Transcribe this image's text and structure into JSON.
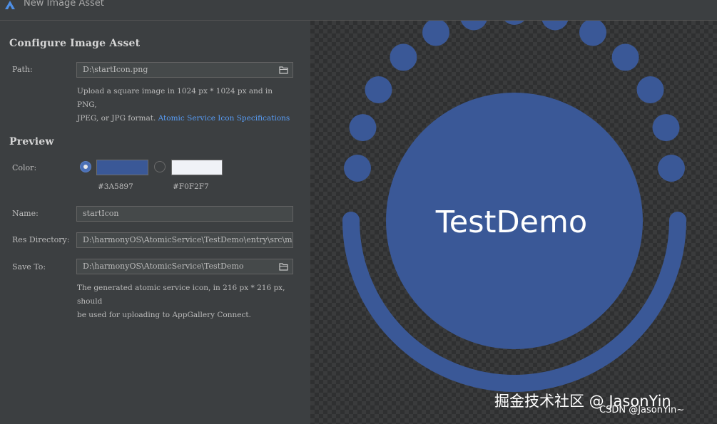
{
  "window": {
    "title": "New Image Asset"
  },
  "configure": {
    "heading": "Configure Image Asset",
    "path_label": "Path:",
    "path_value": "D:\\startIcon.png",
    "help_line1": "Upload a square image in 1024 px * 1024 px and in PNG,",
    "help_line2": "JPEG, or JPG format.",
    "help_link": "Atomic Service Icon Specifications"
  },
  "preview_section": {
    "heading": "Preview",
    "color_label": "Color:",
    "colors": [
      {
        "hex": "#3A5897",
        "selected": true
      },
      {
        "hex": "#F0F2F7",
        "selected": false
      }
    ],
    "name_label": "Name:",
    "name_value": "startIcon",
    "res_label": "Res Directory:",
    "res_value": "D:\\harmonyOS\\AtomicService\\TestDemo\\entry\\src\\main\\resources",
    "save_label": "Save To:",
    "save_value": "D:\\harmonyOS\\AtomicService\\TestDemo",
    "save_help_line1": "The generated atomic service icon, in 216 px * 216 px, should",
    "save_help_line2": "be used for uploading to AppGallery Connect."
  },
  "icon_preview": {
    "text": "TestDemo",
    "fill_color": "#3A5897",
    "text_color": "#FFFFFF",
    "dot_count": 13
  },
  "watermark": {
    "main": "掘金技术社区 @ JasonYin",
    "sub": "CSDN @JasonYin~"
  },
  "icons": {
    "app_logo": "harmony-logo-icon",
    "folder": "folder-icon"
  }
}
